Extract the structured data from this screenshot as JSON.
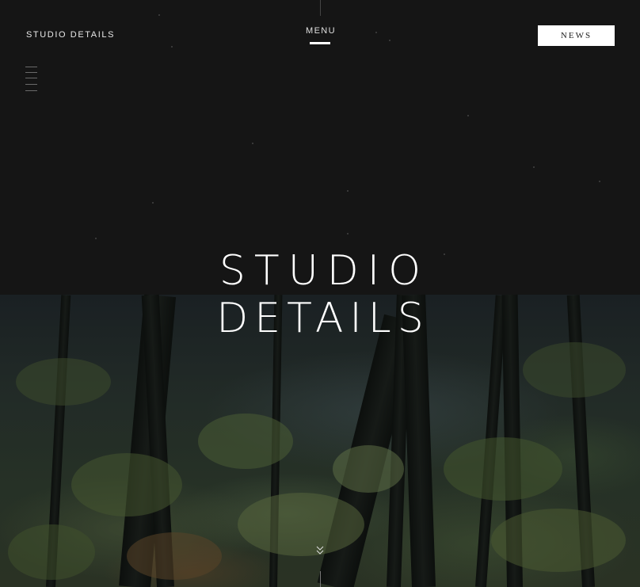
{
  "header": {
    "brand": "STUDIO DETAILS",
    "menu_label": "MENU",
    "news_label": "NEWS"
  },
  "hero": {
    "logo_line1": "STUDIO",
    "logo_line2": "DETAILS"
  },
  "icons": {
    "side_menu": "hamburger-lines-icon",
    "scroll": "double-chevron-down-icon"
  },
  "colors": {
    "background": "#141414",
    "text": "#ffffff",
    "button_bg": "#ffffff",
    "button_text": "#222222"
  }
}
